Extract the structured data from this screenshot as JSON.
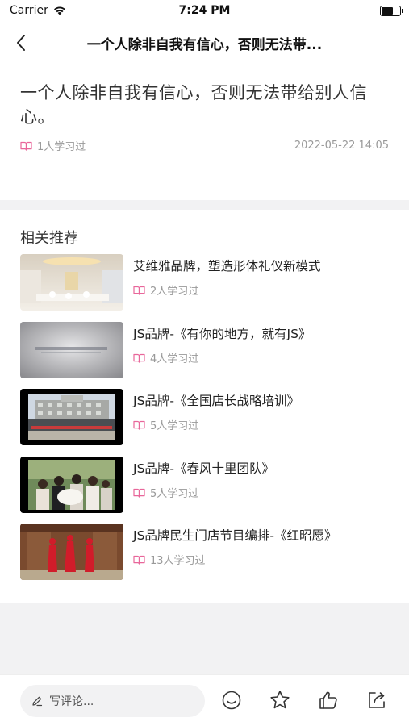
{
  "status_bar": {
    "carrier": "Carrier",
    "time": "7:24 PM"
  },
  "nav": {
    "title": "一个人除非自我有信心，否则无法带..."
  },
  "article": {
    "title": "一个人除非自我有信心，否则无法带给别人信心。",
    "learned": "1人学习过",
    "date": "2022-05-22 14:05"
  },
  "recommendations": {
    "heading": "相关推荐",
    "items": [
      {
        "title": "艾维雅品牌，塑造形体礼仪新模式",
        "learned": "2人学习过"
      },
      {
        "title": "JS品牌-《有你的地方，就有JS》",
        "learned": "4人学习过"
      },
      {
        "title": "JS品牌-《全国店长战略培训》",
        "learned": "5人学习过"
      },
      {
        "title": "JS品牌-《春风十里团队》",
        "learned": "5人学习过"
      },
      {
        "title": "JS品牌民生门店节目编排-《红昭愿》",
        "learned": "13人学习过"
      }
    ]
  },
  "bottom_bar": {
    "comment_placeholder": "写评论...",
    "icons": [
      "comment-icon",
      "star-icon",
      "thumbs-up-icon",
      "share-icon"
    ]
  },
  "colors": {
    "accent_pink": "#e8669a",
    "text_gray": "#999999",
    "background": "#f2f2f3"
  }
}
